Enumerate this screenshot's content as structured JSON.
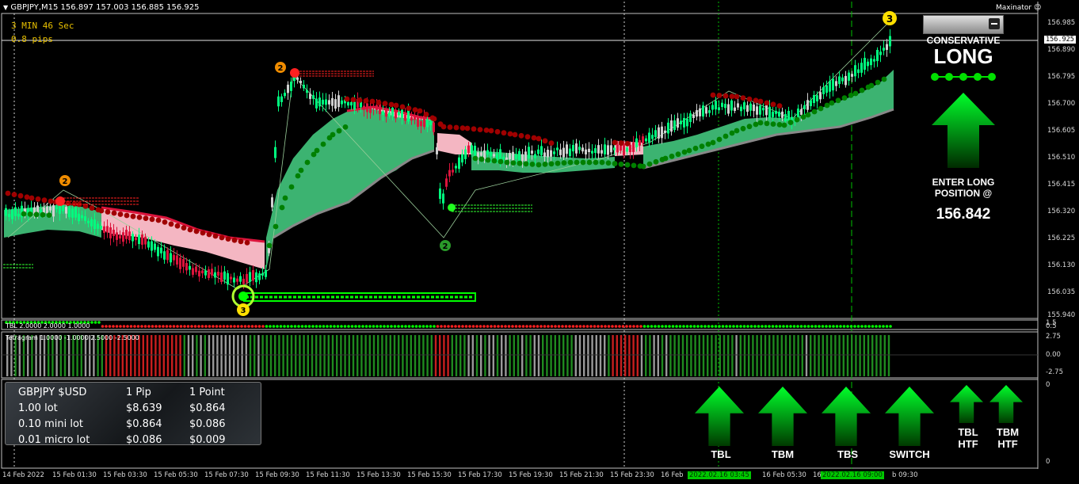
{
  "header": {
    "symbol_info": "GBPJPY,M15  156.897 157.003 156.885 156.925",
    "countdown": "3 MIN 46 Sec",
    "spread": "0.8 pips",
    "brand": "Maxinator"
  },
  "price_axis": {
    "labels": [
      "156.985",
      "156.890",
      "156.795",
      "156.700",
      "156.605",
      "156.510",
      "156.415",
      "156.320",
      "156.225",
      "156.130",
      "156.035",
      "155.940"
    ],
    "current_price": "156.925"
  },
  "dashboard": {
    "mode": "CONSERVATIVE",
    "direction": "LONG",
    "enter_text_1": "ENTER LONG",
    "enter_text_2": "POSITION @",
    "entry_price": "156.842"
  },
  "tbl_panel": {
    "label": "TBL 2.0000 2.0000 1.0000",
    "axis_top": "1.5",
    "axis_bottom": "0.5"
  },
  "tetragram_panel": {
    "label": "Tetragram 1.0000 -1.0000 2.5000 -2.5000",
    "axis": [
      "2.75",
      "0.00",
      "-2.75"
    ]
  },
  "bottom_panel": {
    "axis_top": "0",
    "axis_bottom": "0"
  },
  "pip_table": {
    "headers": [
      "GBPJPY $USD",
      "1 Pip",
      "1 Point"
    ],
    "rows": [
      [
        "1.00 lot",
        "$8.639",
        "$0.864"
      ],
      [
        "0.10 mini lot",
        "$0.864",
        "$0.086"
      ],
      [
        "0.01 micro lot",
        "$0.086",
        "$0.009"
      ]
    ]
  },
  "signals": [
    {
      "label": "TBL",
      "direction": "up"
    },
    {
      "label": "TBM",
      "direction": "up"
    },
    {
      "label": "TBS",
      "direction": "up"
    },
    {
      "label": "SWITCH",
      "direction": "up"
    },
    {
      "label": "TBL\nHTF",
      "direction": "up"
    },
    {
      "label": "TBM\nHTF",
      "direction": "up"
    }
  ],
  "time_axis": {
    "labels": [
      "14 Feb 2022",
      "15 Feb 01:30",
      "15 Feb 03:30",
      "15 Feb 05:30",
      "15 Feb 07:30",
      "15 Feb 09:30",
      "15 Feb 11:30",
      "15 Feb 13:30",
      "15 Feb 15:30",
      "15 Feb 17:30",
      "15 Feb 19:30",
      "15 Feb 21:30",
      "15 Feb 23:30",
      "16 Feb",
      "16 Feb 05:30",
      "16 Feb",
      "b 09:30"
    ],
    "highlight_1": "2022.02.16 03:45",
    "highlight_2": "2022.02.16 09:00"
  },
  "markers": {
    "swing_2": "2",
    "swing_3": "3"
  },
  "colors": {
    "bull": "#00ff7f",
    "bear": "#dc143c",
    "cloud_bull": "#3cb371",
    "cloud_bear": "#f4b6c2",
    "dot_bull": "#008000",
    "dot_bear": "#a00000"
  }
}
